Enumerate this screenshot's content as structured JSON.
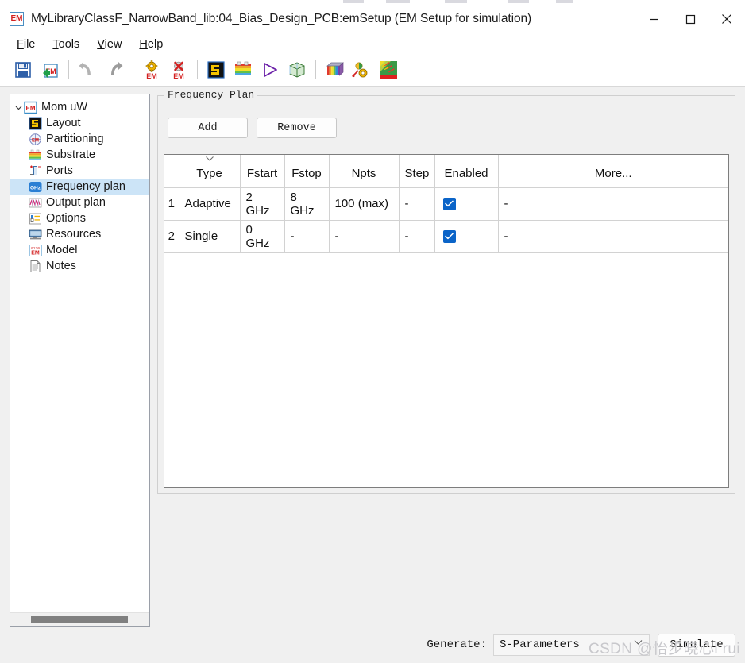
{
  "window": {
    "title": "MyLibraryClassF_NarrowBand_lib:04_Bias_Design_PCB:emSetup (EM Setup for simulation)",
    "app_icon": "em-icon",
    "minimize_label": "Minimize",
    "maximize_label": "Maximize",
    "close_label": "Close"
  },
  "menubar": {
    "items": [
      {
        "label": "File",
        "accel": "F",
        "rest": "ile"
      },
      {
        "label": "Tools",
        "accel": "T",
        "rest": "ools"
      },
      {
        "label": "View",
        "accel": "V",
        "rest": "iew"
      },
      {
        "label": "Help",
        "accel": "H",
        "rest": "elp"
      }
    ]
  },
  "toolbar": {
    "buttons": [
      {
        "name": "save-icon",
        "tooltip": "Save"
      },
      {
        "name": "save-em-setup-icon",
        "tooltip": "Save EM Setup"
      },
      {
        "name": "undo-icon",
        "tooltip": "Undo"
      },
      {
        "name": "redo-icon",
        "tooltip": "Redo"
      },
      {
        "name": "em-settings-icon",
        "tooltip": "EM Settings"
      },
      {
        "name": "em-delete-icon",
        "tooltip": "Delete EM Setup"
      },
      {
        "name": "layout-icon",
        "tooltip": "Layout"
      },
      {
        "name": "substrate-icon",
        "tooltip": "Substrate"
      },
      {
        "name": "simulate-play-icon",
        "tooltip": "Simulate"
      },
      {
        "name": "em-cosim-icon",
        "tooltip": "3D EM Preview"
      },
      {
        "name": "visualization-icon",
        "tooltip": "EM Visualization"
      },
      {
        "name": "em-optimize-icon",
        "tooltip": "EM Optimization"
      },
      {
        "name": "em-model-icon",
        "tooltip": "EM Model"
      }
    ]
  },
  "sidebar": {
    "root": {
      "label": "Mom uW",
      "icon": "em-icon",
      "expanded": true
    },
    "items": [
      {
        "label": "Layout",
        "icon": "layout-icon"
      },
      {
        "label": "Partitioning",
        "icon": "partitioning-icon"
      },
      {
        "label": "Substrate",
        "icon": "substrate-icon"
      },
      {
        "label": "Ports",
        "icon": "ports-icon"
      },
      {
        "label": "Frequency plan",
        "icon": "frequency-icon",
        "selected": true
      },
      {
        "label": "Output plan",
        "icon": "output-plan-icon"
      },
      {
        "label": "Options",
        "icon": "options-icon"
      },
      {
        "label": "Resources",
        "icon": "resources-icon"
      },
      {
        "label": "Model",
        "icon": "model-icon"
      },
      {
        "label": "Notes",
        "icon": "notes-icon"
      }
    ]
  },
  "frequency_plan": {
    "group_title": "Frequency Plan",
    "add_label": "Add",
    "remove_label": "Remove",
    "columns": [
      "",
      "Type",
      "Fstart",
      "Fstop",
      "Npts",
      "Step",
      "Enabled",
      "More..."
    ],
    "sorted_column": "Type",
    "rows": [
      {
        "index": "1",
        "type": "Adaptive",
        "fstart": "2 GHz",
        "fstop": "8 GHz",
        "npts": "100 (max)",
        "step": "-",
        "enabled": true,
        "more": "-"
      },
      {
        "index": "2",
        "type": "Single",
        "fstart": "0 GHz",
        "fstop": "-",
        "npts": "-",
        "step": "-",
        "enabled": true,
        "more": "-"
      }
    ]
  },
  "footer": {
    "generate_label": "Generate:",
    "generate_value": "S-Parameters",
    "simulate_label": "Simulate"
  },
  "watermark": "CSDN @怡步晓心l rui",
  "colors": {
    "selection": "#cce4f7",
    "checkbox": "#0b64c8",
    "window_bg": "#f0f0f0",
    "accent_red": "#d32020"
  }
}
